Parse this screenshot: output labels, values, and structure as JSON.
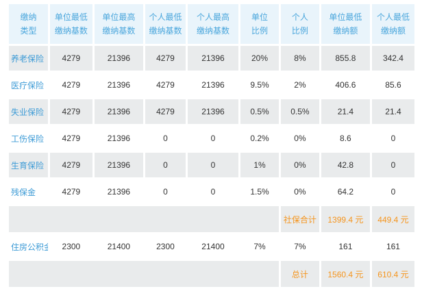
{
  "headers": [
    {
      "line1": "缴纳",
      "line2": "类型"
    },
    {
      "line1": "单位最低",
      "line2": "缴纳基数"
    },
    {
      "line1": "单位最高",
      "line2": "缴纳基数"
    },
    {
      "line1": "个人最低",
      "line2": "缴纳基数"
    },
    {
      "line1": "个人最高",
      "line2": "缴纳基数"
    },
    {
      "line1": "单位",
      "line2": "比例"
    },
    {
      "line1": "个人",
      "line2": "比例"
    },
    {
      "line1": "单位最低",
      "line2": "缴纳额"
    },
    {
      "line1": "个人最低",
      "line2": "缴纳额"
    }
  ],
  "rows": [
    {
      "name": "养老保险",
      "unit_min_base": "4279",
      "unit_max_base": "21396",
      "personal_min_base": "4279",
      "personal_max_base": "21396",
      "unit_rate": "20%",
      "personal_rate": "8%",
      "unit_min_amount": "855.8",
      "personal_min_amount": "342.4"
    },
    {
      "name": "医疗保险",
      "unit_min_base": "4279",
      "unit_max_base": "21396",
      "personal_min_base": "4279",
      "personal_max_base": "21396",
      "unit_rate": "9.5%",
      "personal_rate": "2%",
      "unit_min_amount": "406.6",
      "personal_min_amount": "85.6"
    },
    {
      "name": "失业保险",
      "unit_min_base": "4279",
      "unit_max_base": "21396",
      "personal_min_base": "4279",
      "personal_max_base": "21396",
      "unit_rate": "0.5%",
      "personal_rate": "0.5%",
      "unit_min_amount": "21.4",
      "personal_min_amount": "21.4"
    },
    {
      "name": "工伤保险",
      "unit_min_base": "4279",
      "unit_max_base": "21396",
      "personal_min_base": "0",
      "personal_max_base": "0",
      "unit_rate": "0.2%",
      "personal_rate": "0%",
      "unit_min_amount": "8.6",
      "personal_min_amount": "0"
    },
    {
      "name": "生育保险",
      "unit_min_base": "4279",
      "unit_max_base": "21396",
      "personal_min_base": "0",
      "personal_max_base": "0",
      "unit_rate": "1%",
      "personal_rate": "0%",
      "unit_min_amount": "42.8",
      "personal_min_amount": "0"
    },
    {
      "name": "残保金",
      "unit_min_base": "4279",
      "unit_max_base": "21396",
      "personal_min_base": "0",
      "personal_max_base": "0",
      "unit_rate": "1.5%",
      "personal_rate": "0%",
      "unit_min_amount": "64.2",
      "personal_min_amount": "0"
    }
  ],
  "social_total": {
    "label": "社保合计",
    "unit": "1399.4 元",
    "personal": "449.4 元"
  },
  "housing_fund": {
    "name": "住房公积金",
    "unit_min_base": "2300",
    "unit_max_base": "21400",
    "personal_min_base": "2300",
    "personal_max_base": "21400",
    "unit_rate": "7%",
    "personal_rate": "7%",
    "unit_min_amount": "161",
    "personal_min_amount": "161"
  },
  "grand_total": {
    "label": "总计",
    "unit": "1560.4 元",
    "personal": "610.4 元"
  },
  "colors": {
    "header_bg": "#e9f4fb",
    "header_text": "#4aa6dc",
    "row_band": "#e9ebec",
    "name_text": "#3d9bd6",
    "total_text": "#f5941c"
  }
}
